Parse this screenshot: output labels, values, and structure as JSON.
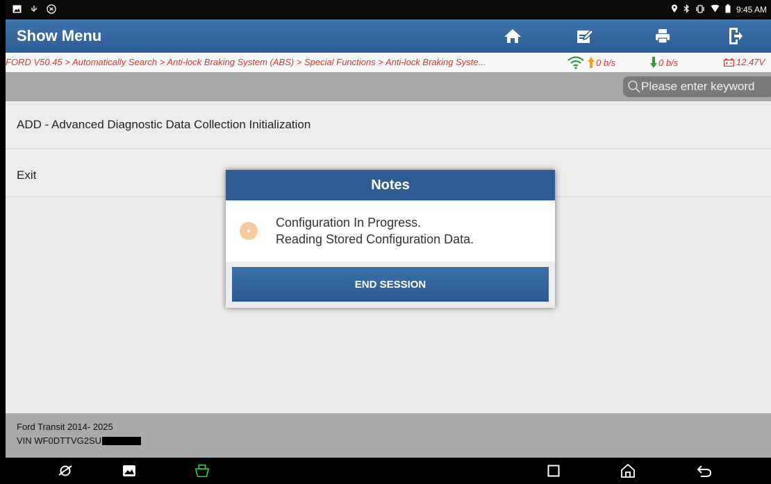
{
  "status_bar": {
    "time": "9:45 AM",
    "icons": [
      "image-icon",
      "usb-icon",
      "vci-icon",
      "location-icon",
      "bluetooth-icon",
      "vibrate-icon",
      "wifi-icon",
      "battery-icon"
    ]
  },
  "header": {
    "title": "Show Menu",
    "buttons": [
      "home-icon",
      "edit-icon",
      "print-icon",
      "exit-icon"
    ]
  },
  "breadcrumb": {
    "path": "FORD V50.45 > Automatically Search > Anti-lock Braking System (ABS) > Special Functions > Anti-lock Braking Syste...",
    "upload": "0 b/s",
    "download": "0 b/s",
    "voltage": "12.47V"
  },
  "search": {
    "placeholder": "Please enter keyword"
  },
  "menu": {
    "items": [
      {
        "label": "ADD - Advanced Diagnostic Data Collection Initialization"
      },
      {
        "label": "Exit"
      }
    ]
  },
  "footer": {
    "vehicle": "Ford Transit 2014- 2025",
    "vin": "VIN WF0DTTVG2SU"
  },
  "dialog": {
    "title": "Notes",
    "line1": "Configuration In Progress.",
    "line2": "Reading Stored Configuration Data.",
    "button": "END SESSION"
  },
  "colors": {
    "header_blue": "#2d5d93",
    "breadcrumb_red": "#d43a2c",
    "upload_arrow": "#f0a020",
    "download_arrow": "#2e9a3a",
    "vci_green": "#2fcb42"
  }
}
